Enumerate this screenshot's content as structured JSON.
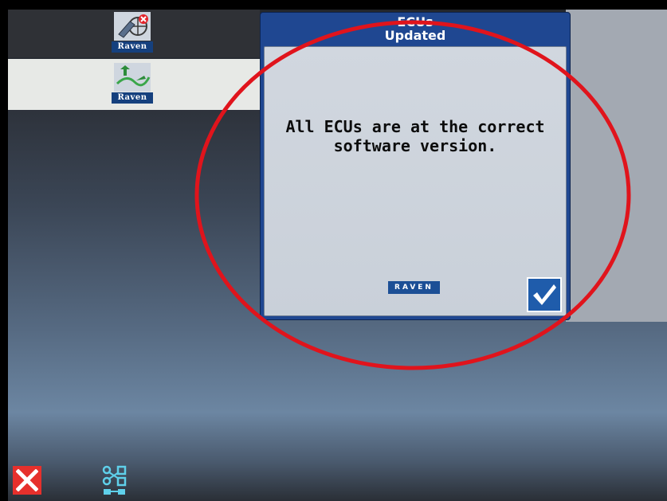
{
  "apps": [
    {
      "name": "machine-diagnostics",
      "brand": "Raven"
    },
    {
      "name": "field-guidance",
      "brand": "Raven"
    }
  ],
  "dialog": {
    "title_line1": "ECUs",
    "title_line2": "Updated",
    "message": "All ECUs are at the correct software version.",
    "brand_logo": "RAVEN",
    "confirm_icon": "checkmark-icon"
  },
  "toolbar": {
    "close_icon": "close-icon",
    "network_icon": "network-diagram-icon"
  },
  "colors": {
    "dialog_header": "#1f4791",
    "brand_blue": "#15407e",
    "close_red": "#e6302c",
    "annotation_red": "#e0141c"
  }
}
